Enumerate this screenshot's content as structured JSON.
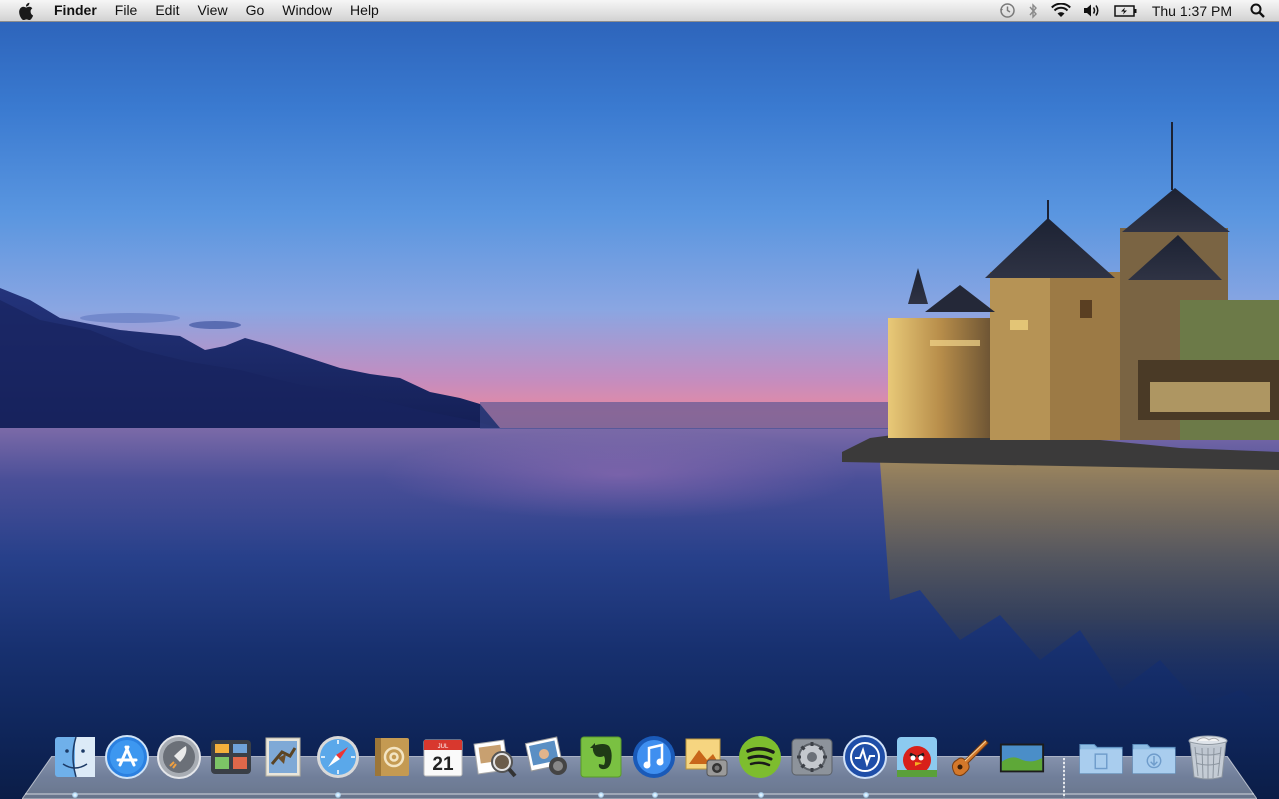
{
  "menubar": {
    "app_name": "Finder",
    "menus": [
      "File",
      "Edit",
      "View",
      "Go",
      "Window",
      "Help"
    ],
    "clock": "Thu 1:37 PM",
    "status_icons": [
      "time-machine-icon",
      "bluetooth-icon",
      "wifi-icon",
      "volume-icon",
      "battery-icon",
      "spotlight-icon"
    ]
  },
  "dock": {
    "apps": [
      "finder-icon",
      "app-store-icon",
      "launchpad-icon",
      "mission-control-icon",
      "mail-icon",
      "safari-icon",
      "contacts-icon",
      "calendar-icon",
      "preview-icon",
      "iphoto-icon",
      "evernote-icon",
      "itunes-icon",
      "photo-booth-icon",
      "spotify-icon",
      "system-preferences-icon",
      "istat-icon",
      "angry-birds-icon",
      "garageband-icon",
      "desktop-icon"
    ],
    "calendar_day": "21",
    "calendar_month": "JUL",
    "stacks": [
      "documents-folder-icon",
      "downloads-folder-icon",
      "trash-icon"
    ]
  }
}
